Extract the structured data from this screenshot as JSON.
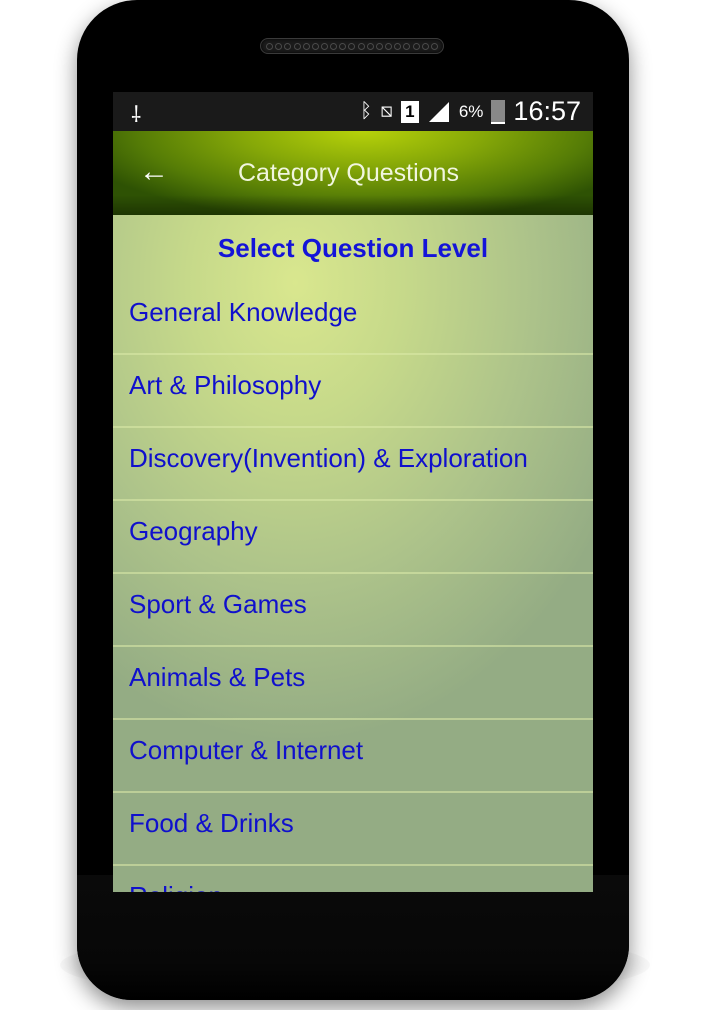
{
  "status_bar": {
    "left_icon": "usb-icon",
    "icons": [
      "bluetooth-icon",
      "vibrate-mute-icon",
      "sim-1-icon",
      "signal-icon",
      "battery-charging-icon"
    ],
    "sim_label": "1",
    "battery_percent": "6%",
    "time": "16:57"
  },
  "app_bar": {
    "back_icon": "back-arrow-icon",
    "title": "Category Questions"
  },
  "content": {
    "subheading": "Select Question Level",
    "categories": [
      {
        "label": "General Knowledge"
      },
      {
        "label": "Art & Philosophy"
      },
      {
        "label": "Discovery(Invention) & Exploration"
      },
      {
        "label": "Geography"
      },
      {
        "label": "Sport & Games"
      },
      {
        "label": "Animals & Pets"
      },
      {
        "label": "Computer & Internet"
      },
      {
        "label": "Food & Drinks"
      },
      {
        "label": "Religion"
      }
    ]
  },
  "colors": {
    "link_blue": "#1010cc",
    "heading_blue": "#1414d8",
    "app_bar_green": "#86a808",
    "status_bar": "#1a1a1a"
  }
}
